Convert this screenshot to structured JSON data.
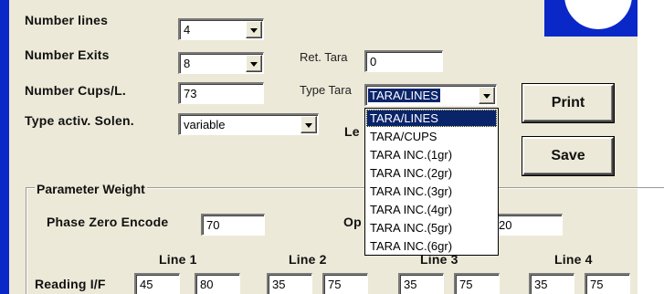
{
  "labels": {
    "number_lines": "Number lines",
    "number_exits": "Number Exits",
    "number_cups": "Number Cups/L.",
    "type_activ": "Type activ. Solen.",
    "ret_tara": "Ret. Tara",
    "type_tara": "Type Tara",
    "len": "Le",
    "group_title": "Parameter Weight",
    "phase_zero": "Phase Zero Encode",
    "op": "Op",
    "reading": "Reading I/F"
  },
  "fields": {
    "number_lines": "4",
    "number_exits": "8",
    "number_cups": "73",
    "type_activ": "variable",
    "ret_tara": "0",
    "type_tara": "TARA/LINES",
    "phase_zero": "70",
    "op_value": "20"
  },
  "buttons": {
    "print": "Print",
    "save": "Save"
  },
  "dropdown": {
    "options": [
      "TARA/LINES",
      "TARA/CUPS",
      "TARA INC.(1gr)",
      "TARA INC.(2gr)",
      "TARA INC.(3gr)",
      "TARA INC.(4gr)",
      "TARA INC.(5gr)",
      "TARA INC.(6gr)"
    ],
    "selected": "TARA/LINES"
  },
  "lines": {
    "headers": [
      "Line 1",
      "Line 2",
      "Line 3",
      "Line 4"
    ],
    "reading_values": [
      "45",
      "80",
      "35",
      "75",
      "35",
      "75",
      "35",
      "75"
    ]
  },
  "colors": {
    "accent_blue": "#0a28c8",
    "panel_bg": "#ece9d8",
    "selection": "#0a246a"
  }
}
